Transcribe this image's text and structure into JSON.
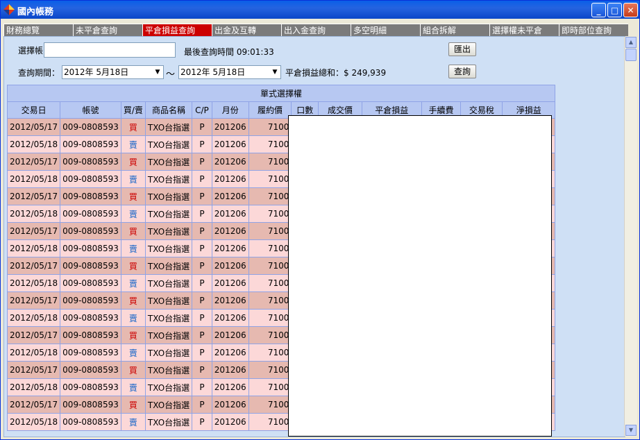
{
  "window": {
    "title": "國內帳務"
  },
  "tabs": [
    "財務總覽",
    "未平倉查詢",
    "平倉損益查詢",
    "出金及互轉",
    "出入金查詢",
    "多空明細",
    "組合拆解",
    "選擇權未平倉",
    "即時部位查詢"
  ],
  "active_tab": "平倉損益查詢",
  "form": {
    "account_label": "選擇帳",
    "account_value": "",
    "last_query_time": "最後查詢時間 09:01:33",
    "export_button": "匯出",
    "period_label": "查詢期間：",
    "date_from": "2012年  5月18日",
    "separator": "～",
    "date_to": "2012年  5月18日",
    "total_label": "平倉損益總和：$ 249,939",
    "query_button": "查詢"
  },
  "table": {
    "group_header": "單式選擇權",
    "columns": [
      "交易日",
      "帳號",
      "買/賣",
      "商品名稱",
      "C/P",
      "月份",
      "履約價",
      "口數",
      "成交價",
      "平倉損益",
      "手續費",
      "交易稅",
      "淨損益"
    ],
    "rows": [
      [
        "2012/05/17",
        "009-0808593",
        "買",
        "TXO台指選",
        "P",
        "201206",
        "7100"
      ],
      [
        "2012/05/18",
        "009-0808593",
        "賣",
        "TXO台指選",
        "P",
        "201206",
        "7100"
      ],
      [
        "2012/05/17",
        "009-0808593",
        "買",
        "TXO台指選",
        "P",
        "201206",
        "7100"
      ],
      [
        "2012/05/18",
        "009-0808593",
        "賣",
        "TXO台指選",
        "P",
        "201206",
        "7100"
      ],
      [
        "2012/05/17",
        "009-0808593",
        "買",
        "TXO台指選",
        "P",
        "201206",
        "7100"
      ],
      [
        "2012/05/18",
        "009-0808593",
        "賣",
        "TXO台指選",
        "P",
        "201206",
        "7100"
      ],
      [
        "2012/05/17",
        "009-0808593",
        "買",
        "TXO台指選",
        "P",
        "201206",
        "7100"
      ],
      [
        "2012/05/18",
        "009-0808593",
        "賣",
        "TXO台指選",
        "P",
        "201206",
        "7100"
      ],
      [
        "2012/05/17",
        "009-0808593",
        "買",
        "TXO台指選",
        "P",
        "201206",
        "7100"
      ],
      [
        "2012/05/18",
        "009-0808593",
        "賣",
        "TXO台指選",
        "P",
        "201206",
        "7100"
      ],
      [
        "2012/05/17",
        "009-0808593",
        "買",
        "TXO台指選",
        "P",
        "201206",
        "7100"
      ],
      [
        "2012/05/18",
        "009-0808593",
        "賣",
        "TXO台指選",
        "P",
        "201206",
        "7100"
      ],
      [
        "2012/05/17",
        "009-0808593",
        "買",
        "TXO台指選",
        "P",
        "201206",
        "7100"
      ],
      [
        "2012/05/18",
        "009-0808593",
        "賣",
        "TXO台指選",
        "P",
        "201206",
        "7100"
      ],
      [
        "2012/05/17",
        "009-0808593",
        "買",
        "TXO台指選",
        "P",
        "201206",
        "7100"
      ],
      [
        "2012/05/18",
        "009-0808593",
        "賣",
        "TXO台指選",
        "P",
        "201206",
        "7100"
      ],
      [
        "2012/05/17",
        "009-0808593",
        "買",
        "TXO台指選",
        "P",
        "201206",
        "7100"
      ],
      [
        "2012/05/18",
        "009-0808593",
        "賣",
        "TXO台指選",
        "P",
        "201206",
        "7100"
      ]
    ]
  },
  "colors": {
    "buy": "#cc0000",
    "sell": "#1464c8",
    "active_tab": "#cc0000"
  }
}
